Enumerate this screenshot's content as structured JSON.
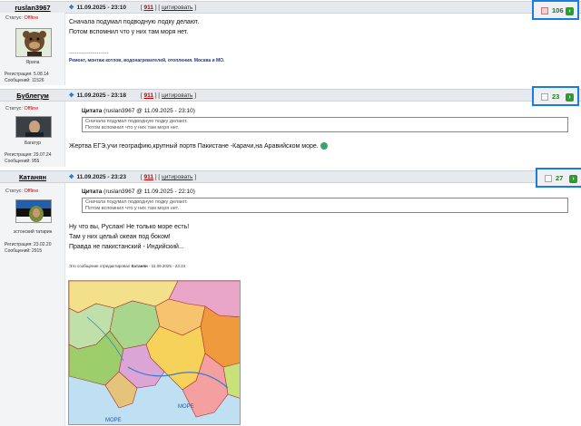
{
  "posts": [
    {
      "author": "ruslan3967",
      "datetime": "11.09.2025 - 23:10",
      "post_num": "911",
      "quote_action": "цитировать",
      "status_label": "Статус:",
      "status_value": "Offline",
      "avatar_caption": "Ярила",
      "registration": "Регистрация: 5.08.14",
      "messages": "Сообщений: 11526",
      "lines": [
        "Сначала подумал подводную лодку делают.",
        "Потом вспомнил что у них там моря нет."
      ],
      "sig_separator": "--------------------",
      "signature": "Ремонт, монтаж котлов, водонагревателей, отопления. Москва и МО.",
      "rating": "106"
    },
    {
      "author": "Бублегум",
      "datetime": "11.09.2025 - 23:18",
      "post_num": "911",
      "quote_action": "цитировать",
      "status_label": "Статус:",
      "status_value": "Offline",
      "avatar_caption": "Багатур",
      "registration": "Регистрация: 29.07.24",
      "messages": "Сообщений: 955",
      "quote_word": "Цитата",
      "quote_meta": "(ruslan3967 @ 11.09.2025 - 23:10)",
      "quote_lines": [
        "Сначала подумал подводную лодку делают.",
        "Потом вспомнил что у них там моря нет."
      ],
      "text": "Жертва ЕГЭ,учи географию,крупный портв Пакистане -Карачи,на Аравийском море.",
      "rating": "23"
    },
    {
      "author": "Катанян",
      "datetime": "11.09.2025 - 23:23",
      "post_num": "911",
      "quote_action": "цитировать",
      "status_label": "Статус:",
      "status_value": "Offline",
      "avatar_caption": "эстонский татарин",
      "registration": "Регистрация: 23.02.20",
      "messages": "Сообщений: 2915",
      "quote_word": "Цитата",
      "quote_meta": "(ruslan3967 @ 11.09.2025 - 22:10)",
      "quote_lines": [
        "Сначала подумал подводную лодку делают.",
        "Потом вспомнил что у них там моря нет."
      ],
      "lines": [
        "Ну что вы, Руслан! Не только море есть!",
        "Там у них целый океан под боком!",
        "Правда не пакистанский - Индийский..."
      ],
      "edited_prefix": "Это сообщение отредактировал",
      "edited_by": "Катанян",
      "edited_date": "- 11.09.2025 - 23:24",
      "rating": "27"
    }
  ],
  "map_labels": [
    "МОРЕ",
    "МОРЕ"
  ],
  "colors": {
    "accent_box": "#1a7ce0",
    "offline": "#d00000",
    "rating": "#1f7a22",
    "header_bg": "#e6e9ee"
  }
}
